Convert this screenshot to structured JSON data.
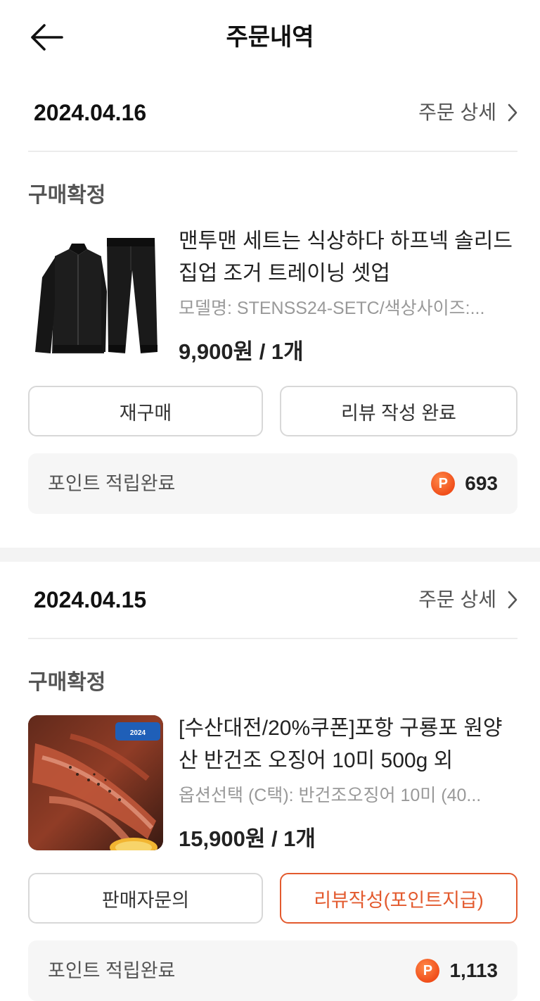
{
  "header": {
    "title": "주문내역"
  },
  "orders": [
    {
      "date": "2024.04.16",
      "detail_label": "주문 상세",
      "status": "구매확정",
      "product": {
        "name": "맨투맨 세트는 식상하다 하프넥 솔리드 집업 조거 트레이닝 셋업",
        "option": "모델명: STENSS24-SETC/색상사이즈:...",
        "price": "9,900원 / 1개"
      },
      "buttons": {
        "left": "재구매",
        "right": "리뷰 작성 완료"
      },
      "points": {
        "label": "포인트 적립완료",
        "badge": "P",
        "value": "693"
      }
    },
    {
      "date": "2024.04.15",
      "detail_label": "주문 상세",
      "status": "구매확정",
      "product": {
        "name": "[수산대전/20%쿠폰]포항 구룡포 원양산 반건조 오징어 10미 500g 외",
        "option": "옵션선택 (C택): 반건조오징어 10미 (40...",
        "price": "15,900원 / 1개",
        "image_text": "2024 대한민국수산대전"
      },
      "buttons": {
        "left": "판매자문의",
        "right": "리뷰작성(포인트지급)"
      },
      "points": {
        "label": "포인트 적립완료",
        "badge": "P",
        "value": "1,113"
      }
    }
  ],
  "colors": {
    "accent": "#e35a2e",
    "point_badge": "#f04e1a",
    "panel_bg": "#f6f6f6",
    "divider_bg": "#f3f3f3"
  },
  "icons": {
    "back": "arrow-left-icon",
    "detail": "chevron-right-icon",
    "point": "point-badge-icon"
  }
}
